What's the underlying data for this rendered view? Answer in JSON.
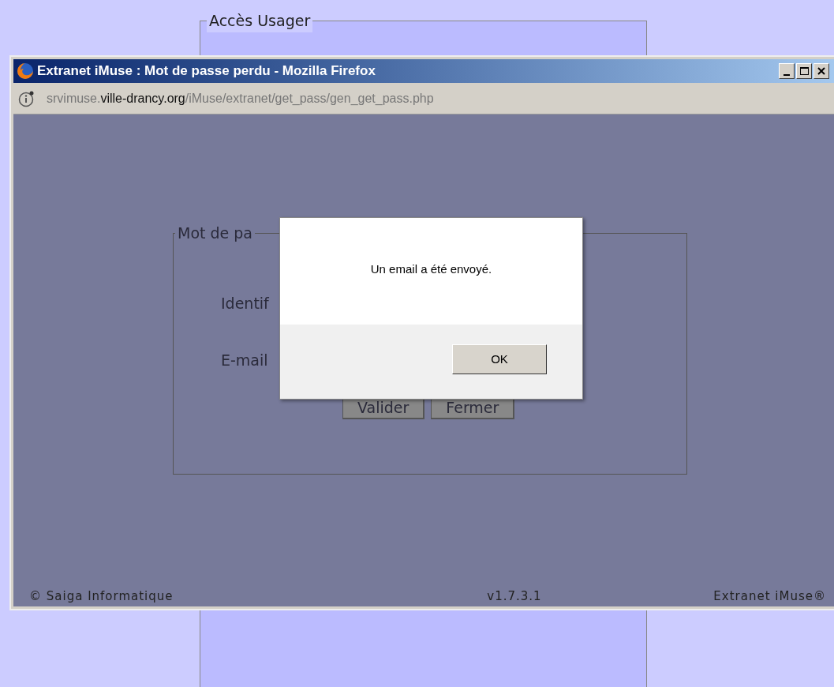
{
  "page": {
    "legend": "Accès Usager"
  },
  "browser": {
    "title": "Extranet iMuse : Mot de passe perdu - Mozilla Firefox",
    "url": "srvimuse.**ville-drancy.org**/iMuse/extranet/get_pass/gen_get_pass.php",
    "form": {
      "legend": "Mot de pa",
      "fields": [
        {
          "label": "Identif"
        },
        {
          "label": "E-mail"
        }
      ],
      "buttons": [
        "Valider",
        "Fermer"
      ]
    },
    "footer": {
      "copyright": "© Saiga Informatique",
      "version": "v1.7.3.1",
      "product": "Extranet iMuse®"
    }
  },
  "dialog": {
    "message": "Un email a été envoyé.",
    "button": "OK"
  }
}
